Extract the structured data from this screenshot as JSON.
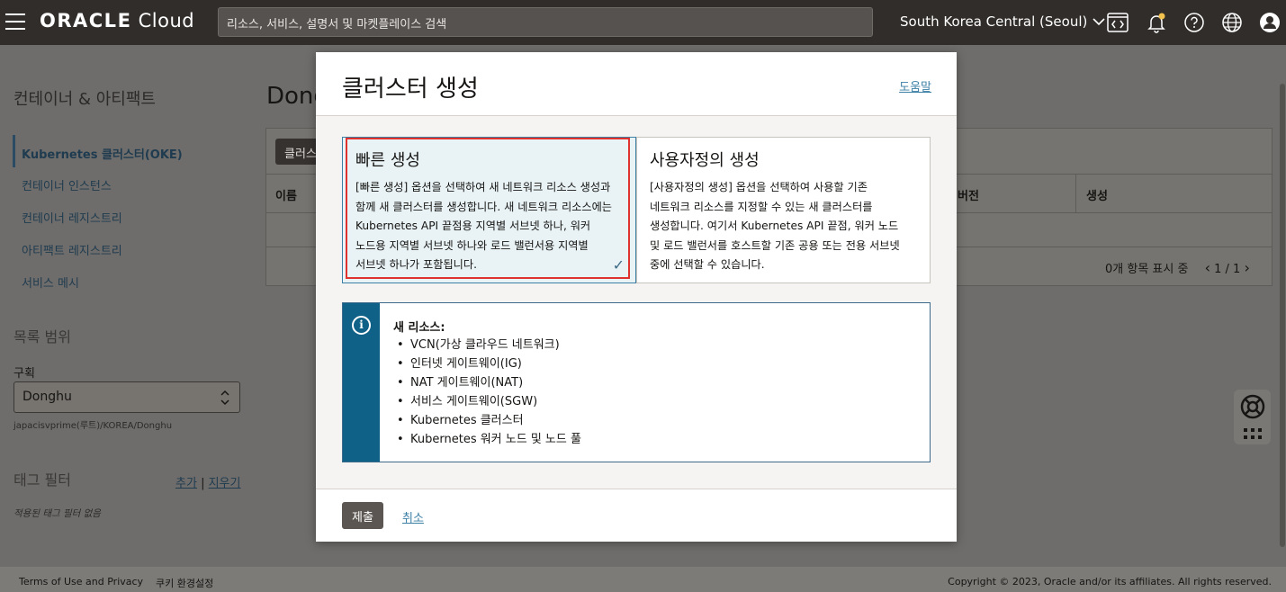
{
  "header": {
    "logo_bold": "ORACLE",
    "logo_light": "Cloud",
    "search_placeholder": "리소스, 서비스, 설명서 및 마켓플레이스 검색",
    "region": "South Korea Central (Seoul)",
    "icons": [
      "menu-icon",
      "code-editor-icon",
      "bell-icon",
      "help-icon",
      "globe-icon",
      "user-icon"
    ]
  },
  "sidebar": {
    "title": "컨테이너 & 아티팩트",
    "items": [
      {
        "label": "Kubernetes 클러스터(OKE)",
        "active": true
      },
      {
        "label": "컨테이너 인스턴스"
      },
      {
        "label": "컨테이너 레지스트리"
      },
      {
        "label": "아티팩트 레지스트리"
      },
      {
        "label": "서비스 메시"
      }
    ],
    "scope_title": "목록 범위",
    "compartment_label": "구획",
    "compartment_value": "Donghu",
    "compartment_path": "japacisvprime(루트)/KOREA/Donghu",
    "tag_filter_title": "태그 필터",
    "tag_add": "추가",
    "tag_separator": "|",
    "tag_clear": "지우기",
    "tag_empty": "적용된 태그 필터 없음"
  },
  "main": {
    "title_partial": "Dong",
    "create_button_partial": "클러스",
    "columns": [
      "이름",
      "버전",
      "생성"
    ],
    "pager_text": "0개 항목 표시 중",
    "pager_pages": "1 / 1"
  },
  "modal": {
    "title": "클러스터 생성",
    "help_link": "도움말",
    "options": [
      {
        "title": "빠른 생성",
        "description": "[빠른 생성] 옵션을 선택하여 새 네트워크 리소스 생성과 함께 새 클러스터를 생성합니다. 새 네트워크 리소스에는 Kubernetes API 끝점용 지역별 서브넷 하나, 워커 노드용 지역별 서브넷 하나와 로드 밸런서용 지역별 서브넷 하나가 포함됩니다.",
        "selected": true
      },
      {
        "title": "사용자정의 생성",
        "description": "[사용자정의 생성] 옵션을 선택하여 사용할 기존 네트워크 리소스를 지정할 수 있는 새 클러스터를 생성합니다. 여기서 Kubernetes API 끝점, 워커 노드 및 로드 밸런서를 호스트할 기존 공용 또는 전용 서브넷 중에 선택할 수 있습니다.",
        "selected": false
      }
    ],
    "info": {
      "heading": "새 리소스:",
      "items": [
        "VCN(가상 클라우드 네트워크)",
        "인터넷 게이트웨이(IG)",
        "NAT 게이트웨이(NAT)",
        "서비스 게이트웨이(SGW)",
        "Kubernetes 클러스터",
        "Kubernetes 워커 노드 및 노드 풀"
      ]
    },
    "submit": "제출",
    "cancel": "취소"
  },
  "footer": {
    "terms": "Terms of Use and Privacy",
    "cookies": "쿠키 환경설정",
    "copyright": "Copyright © 2023, Oracle and/or its affiliates. All rights reserved."
  },
  "colors": {
    "header_bg": "#312d2a",
    "accent": "#0f6187",
    "link": "#3d80a6",
    "highlight": "#e0322e",
    "overlay": "#6f6d6b"
  }
}
